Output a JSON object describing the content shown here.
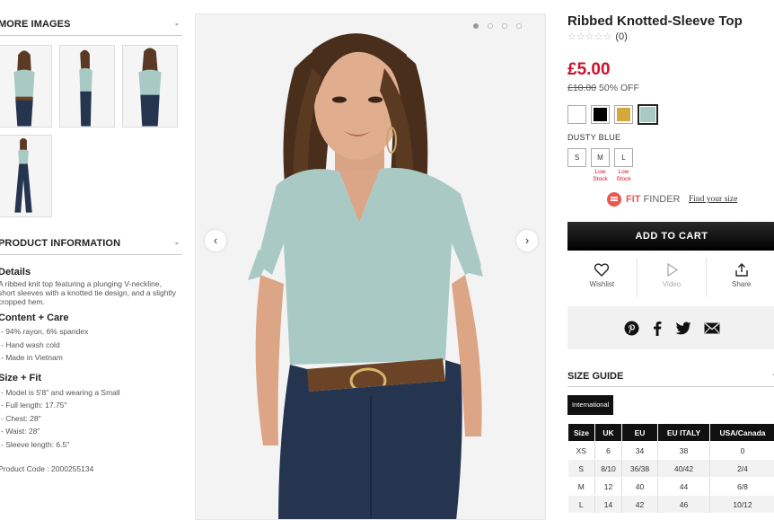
{
  "left": {
    "more_images": {
      "label": "MORE IMAGES",
      "toggle": "-"
    },
    "product_info": {
      "label": "PRODUCT INFORMATION",
      "toggle": "-",
      "details": {
        "heading": "Details",
        "text": "A ribbed knit top featuring a plunging V-neckline, short sleeves with a knotted tie design, and a slightly cropped hem."
      },
      "content_care": {
        "heading": "Content + Care",
        "items": [
          "- 94% rayon, 6% spandex",
          "- Hand wash cold",
          "- Made in Vietnam"
        ]
      },
      "size_fit": {
        "heading": "Size + Fit",
        "items": [
          "- Model is 5'8\" and wearing a Small",
          "- Full length: 17.75\"",
          "- Chest: 28\"",
          "- Waist: 28\"",
          "- Sleeve length: 6.5\""
        ]
      },
      "product_code": "Product Code : 2000255134"
    }
  },
  "gallery": {
    "prev_icon": "‹",
    "next_icon": "›"
  },
  "product": {
    "title": "Ribbed Knotted-Sleeve Top",
    "stars": "☆☆☆☆☆",
    "review_count": "(0)",
    "price": "£5.00",
    "old_price": "£10.00",
    "discount": "50% OFF",
    "colors": [
      {
        "name": "white",
        "hex": "#ffffff"
      },
      {
        "name": "black",
        "hex": "#000000"
      },
      {
        "name": "mustard",
        "hex": "#d4a93c"
      },
      {
        "name": "dusty blue",
        "hex": "#a9c9c4"
      }
    ],
    "selected_color": "DUSTY BLUE",
    "sizes": [
      {
        "label": "S",
        "note": ""
      },
      {
        "label": "M",
        "note": "Low Stock"
      },
      {
        "label": "L",
        "note": "Low Stock"
      }
    ],
    "fit_finder": {
      "brand_bold": "FIT",
      "brand_rest": " FINDER",
      "link": "Find your size"
    },
    "add_to_cart": "ADD TO CART",
    "actions": {
      "wishlist": "Wishlist",
      "video": "Video",
      "share": "Share"
    }
  },
  "size_guide": {
    "label": "SIZE GUIDE",
    "toggle": "-",
    "tab": "International",
    "headers": [
      "Size",
      "UK",
      "EU",
      "EU ITALY",
      "USA/Canada"
    ],
    "rows": [
      [
        "XS",
        "6",
        "34",
        "38",
        "0"
      ],
      [
        "S",
        "8/10",
        "36/38",
        "40/42",
        "2/4"
      ],
      [
        "M",
        "12",
        "40",
        "44",
        "6/8"
      ],
      [
        "L",
        "14",
        "42",
        "46",
        "10/12"
      ]
    ]
  },
  "colors": {
    "price_red": "#d0112b",
    "fitfinder_coral": "#e9594f",
    "top_mint": "#a9c9c4",
    "denim": "#25344f"
  }
}
